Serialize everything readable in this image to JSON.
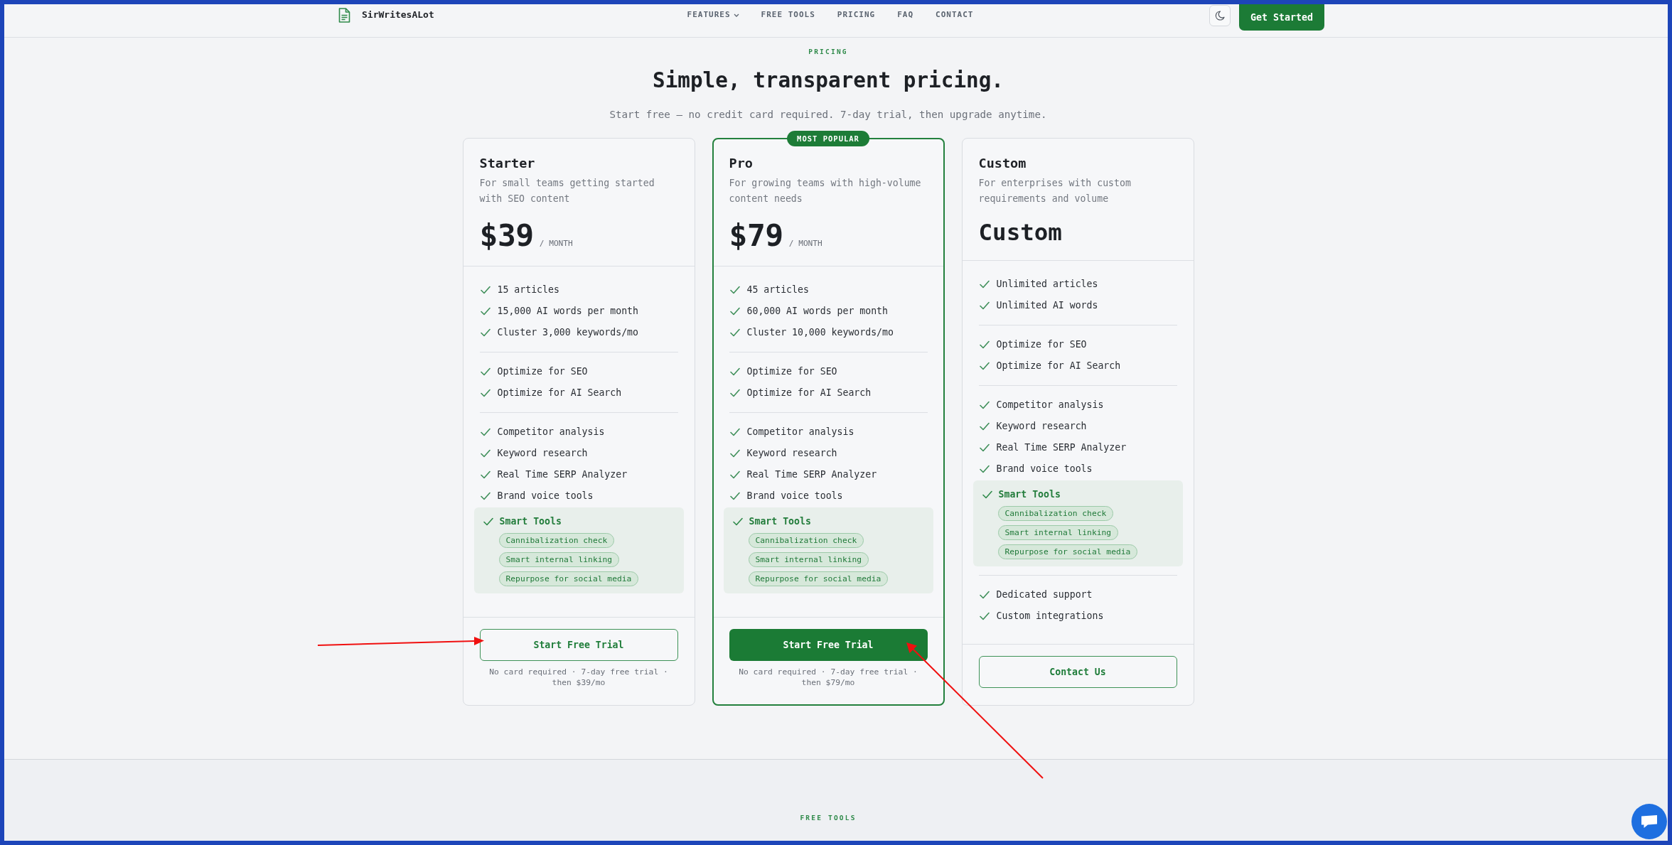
{
  "header": {
    "brand": "SirWritesALot",
    "nav": [
      {
        "label": "FEATURES",
        "dropdown": true
      },
      {
        "label": "FREE TOOLS",
        "dropdown": false
      },
      {
        "label": "PRICING",
        "dropdown": false
      },
      {
        "label": "FAQ",
        "dropdown": false
      },
      {
        "label": "CONTACT",
        "dropdown": false
      }
    ],
    "cta": "Get Started"
  },
  "pricing": {
    "eyebrow": "PRICING",
    "title": "Simple, transparent pricing.",
    "subtitle": "Start free — no credit card required. 7-day trial, then upgrade anytime.",
    "plans": [
      {
        "name": "Starter",
        "description": "For small teams getting started with SEO content",
        "price": {
          "kind": "amount",
          "value": "$39",
          "period": "/ MONTH"
        },
        "featured": false,
        "groups": [
          {
            "kind": "list",
            "items": [
              "15 articles",
              "15,000 AI words per month",
              "Cluster 3,000 keywords/mo"
            ]
          },
          {
            "kind": "list",
            "items": [
              "Optimize for SEO",
              "Optimize for AI Search"
            ]
          },
          {
            "kind": "list",
            "items": [
              "Competitor analysis",
              "Keyword research",
              "Real Time SERP Analyzer",
              "Brand voice tools"
            ]
          },
          {
            "kind": "smart",
            "title": "Smart Tools",
            "tags": [
              "Cannibalization check",
              "Smart internal linking",
              "Repurpose for social media"
            ]
          }
        ],
        "button": "Start Free Trial",
        "note": "No card required · 7-day free trial · then $39/mo"
      },
      {
        "name": "Pro",
        "badge": "MOST POPULAR",
        "description": "For growing teams with high-volume content needs",
        "price": {
          "kind": "amount",
          "value": "$79",
          "period": "/ MONTH"
        },
        "featured": true,
        "groups": [
          {
            "kind": "list",
            "items": [
              "45 articles",
              "60,000 AI words per month",
              "Cluster 10,000 keywords/mo"
            ]
          },
          {
            "kind": "list",
            "items": [
              "Optimize for SEO",
              "Optimize for AI Search"
            ]
          },
          {
            "kind": "list",
            "items": [
              "Competitor analysis",
              "Keyword research",
              "Real Time SERP Analyzer",
              "Brand voice tools"
            ]
          },
          {
            "kind": "smart",
            "title": "Smart Tools",
            "tags": [
              "Cannibalization check",
              "Smart internal linking",
              "Repurpose for social media"
            ]
          }
        ],
        "button": "Start Free Trial",
        "note": "No card required · 7-day free trial · then $79/mo"
      },
      {
        "name": "Custom",
        "description": "For enterprises with custom requirements and volume",
        "price": {
          "kind": "label",
          "value": "Custom"
        },
        "featured": false,
        "groups": [
          {
            "kind": "list",
            "items": [
              "Unlimited articles",
              "Unlimited AI words"
            ]
          },
          {
            "kind": "list",
            "items": [
              "Optimize for SEO",
              "Optimize for AI Search"
            ]
          },
          {
            "kind": "list",
            "items": [
              "Competitor analysis",
              "Keyword research",
              "Real Time SERP Analyzer",
              "Brand voice tools"
            ]
          },
          {
            "kind": "smart",
            "title": "Smart Tools",
            "tags": [
              "Cannibalization check",
              "Smart internal linking",
              "Repurpose for social media"
            ]
          },
          {
            "kind": "list",
            "items": [
              "Dedicated support",
              "Custom integrations"
            ]
          }
        ],
        "button": "Contact Us"
      }
    ]
  },
  "free_tools": {
    "eyebrow": "FREE TOOLS"
  }
}
